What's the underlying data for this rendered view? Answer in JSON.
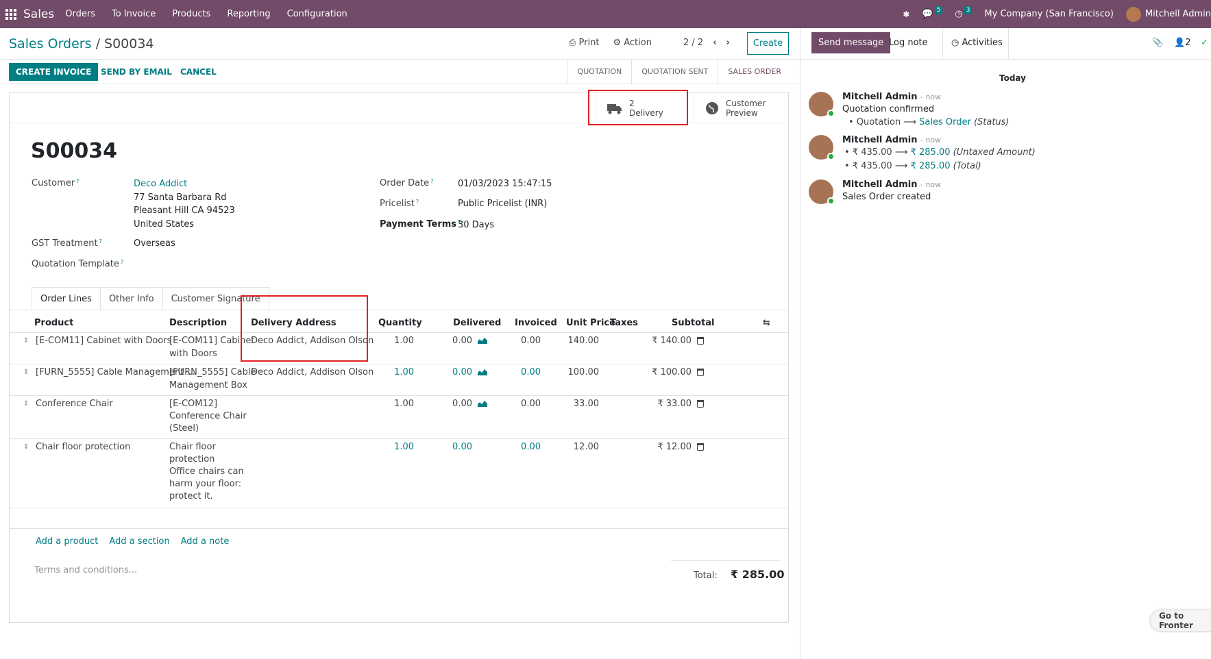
{
  "topnav": {
    "app_name": "Sales",
    "menu": [
      "Orders",
      "To Invoice",
      "Products",
      "Reporting",
      "Configuration"
    ],
    "messages_count": "5",
    "activities_count": "3",
    "company": "My Company (San Francisco)",
    "user": "Mitchell Admin"
  },
  "breadcrumb": {
    "parent": "Sales Orders",
    "separator": "/",
    "current": "S00034"
  },
  "cp_actions": {
    "print": "Print",
    "action": "Action",
    "pager": "2 / 2",
    "create": "Create"
  },
  "statusbar": {
    "create_invoice": "CREATE INVOICE",
    "send_by_email": "SEND BY EMAIL",
    "cancel": "CANCEL",
    "stages": [
      "QUOTATION",
      "QUOTATION SENT",
      "SALES ORDER"
    ],
    "active_stage": "SALES ORDER"
  },
  "smart_buttons": {
    "delivery_count": "2",
    "delivery_label": "Delivery",
    "customer_preview_l1": "Customer",
    "customer_preview_l2": "Preview"
  },
  "order": {
    "name": "S00034",
    "customer_label": "Customer",
    "customer_name": "Deco Addict",
    "address_l1": "77 Santa Barbara Rd",
    "address_l2": "Pleasant Hill CA 94523",
    "address_l3": "United States",
    "gst_label": "GST Treatment",
    "gst_value": "Overseas",
    "template_label": "Quotation Template",
    "order_date_label": "Order Date",
    "order_date": "01/03/2023 15:47:15",
    "pricelist_label": "Pricelist",
    "pricelist": "Public Pricelist (INR)",
    "payment_terms_label": "Payment Terms",
    "payment_terms": "30 Days"
  },
  "tabs": [
    "Order Lines",
    "Other Info",
    "Customer Signature"
  ],
  "table": {
    "headers": [
      "Product",
      "Description",
      "Delivery Address",
      "Quantity",
      "Delivered",
      "Invoiced",
      "Unit Price",
      "Taxes",
      "Subtotal"
    ],
    "rows": [
      {
        "product": "[E-COM11] Cabinet with Doors",
        "desc1": "[E-COM11] Cabinet",
        "desc2": "with Doors",
        "desc3": "",
        "desc4": "",
        "desc5": "",
        "address": "Deco Addict, Addison Olson",
        "qty": "1.00",
        "delivered": "0.00",
        "invoiced": "0.00",
        "price": "140.00",
        "subtotal": "₹ 140.00"
      },
      {
        "product": "[FURN_5555] Cable Management ...",
        "desc1": "[FURN_5555] Cable",
        "desc2": "Management Box",
        "desc3": "",
        "desc4": "",
        "desc5": "",
        "address": "Deco Addict, Addison Olson",
        "qty": "1.00",
        "delivered": "0.00",
        "invoiced": "0.00",
        "price": "100.00",
        "subtotal": "₹ 100.00"
      },
      {
        "product": "Conference Chair",
        "desc1": "[E-COM12]",
        "desc2": "Conference Chair",
        "desc3": "(Steel)",
        "desc4": "",
        "desc5": "",
        "address": "",
        "qty": "1.00",
        "delivered": "0.00",
        "invoiced": "0.00",
        "price": "33.00",
        "subtotal": "₹ 33.00"
      },
      {
        "product": "Chair floor protection",
        "desc1": "Chair floor",
        "desc2": "protection",
        "desc3": "Office chairs can",
        "desc4": "harm your floor:",
        "desc5": "protect it.",
        "address": "",
        "qty": "1.00",
        "delivered": "0.00",
        "invoiced": "0.00",
        "price": "12.00",
        "subtotal": "₹ 12.00"
      }
    ]
  },
  "add_links": {
    "product": "Add a product",
    "section": "Add a section",
    "note": "Add a note"
  },
  "terms_placeholder": "Terms and conditions...",
  "totals": {
    "label": "Total:",
    "value": "₹ 285.00"
  },
  "chatter": {
    "send_message": "Send message",
    "log_note": "Log note",
    "activities": "Activities",
    "followers": "2",
    "today": "Today",
    "messages": [
      {
        "author": "Mitchell Admin",
        "time": "- now",
        "body": "Quotation confirmed",
        "li1_old": "Quotation",
        "li1_new": "Sales Order",
        "li1_field": "(Status)"
      },
      {
        "author": "Mitchell Admin",
        "time": "- now",
        "li1_old": "₹ 435.00",
        "li1_new": "₹ 285.00",
        "li1_field": "(Untaxed Amount)",
        "li2_old": "₹ 435.00",
        "li2_new": "₹ 285.00",
        "li2_field": "(Total)"
      },
      {
        "author": "Mitchell Admin",
        "time": "- now",
        "body": "Sales Order created"
      }
    ],
    "goto_frontend": "Go to Fronter"
  },
  "colors": {
    "brand": "#714b67",
    "accent": "#017e84",
    "highlight": "#e31f24"
  }
}
